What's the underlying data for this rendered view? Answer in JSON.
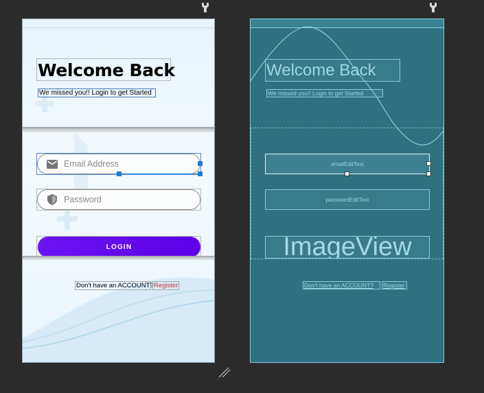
{
  "design": {
    "title": "Welcome Back",
    "subtitle": "We missed you!! Login to get Started",
    "email_placeholder": "Email Address",
    "password_placeholder": "Password",
    "login_label": "LOGIN",
    "no_account_text": "Don't have an ACCOUNT?",
    "register_label": "Register"
  },
  "blueprint": {
    "title": "Welcome Back",
    "subtitle": "We missed you!! Login to get Started",
    "email_id": "emailEditText",
    "password_id": "passwordEditText",
    "image_view_label": "ImageView",
    "no_account_text": "Don't have an ACCOUNT?",
    "register_label": "Register"
  },
  "colors": {
    "canvas": "#2b2b2b",
    "login_button": "#6200ee",
    "register_text": "#d12d2d",
    "blueprint_bg": "#2f7180",
    "selection": "#1e7bd8"
  },
  "icons": [
    "pin-icon",
    "email-icon",
    "shield-icon",
    "resize-grip-icon"
  ]
}
